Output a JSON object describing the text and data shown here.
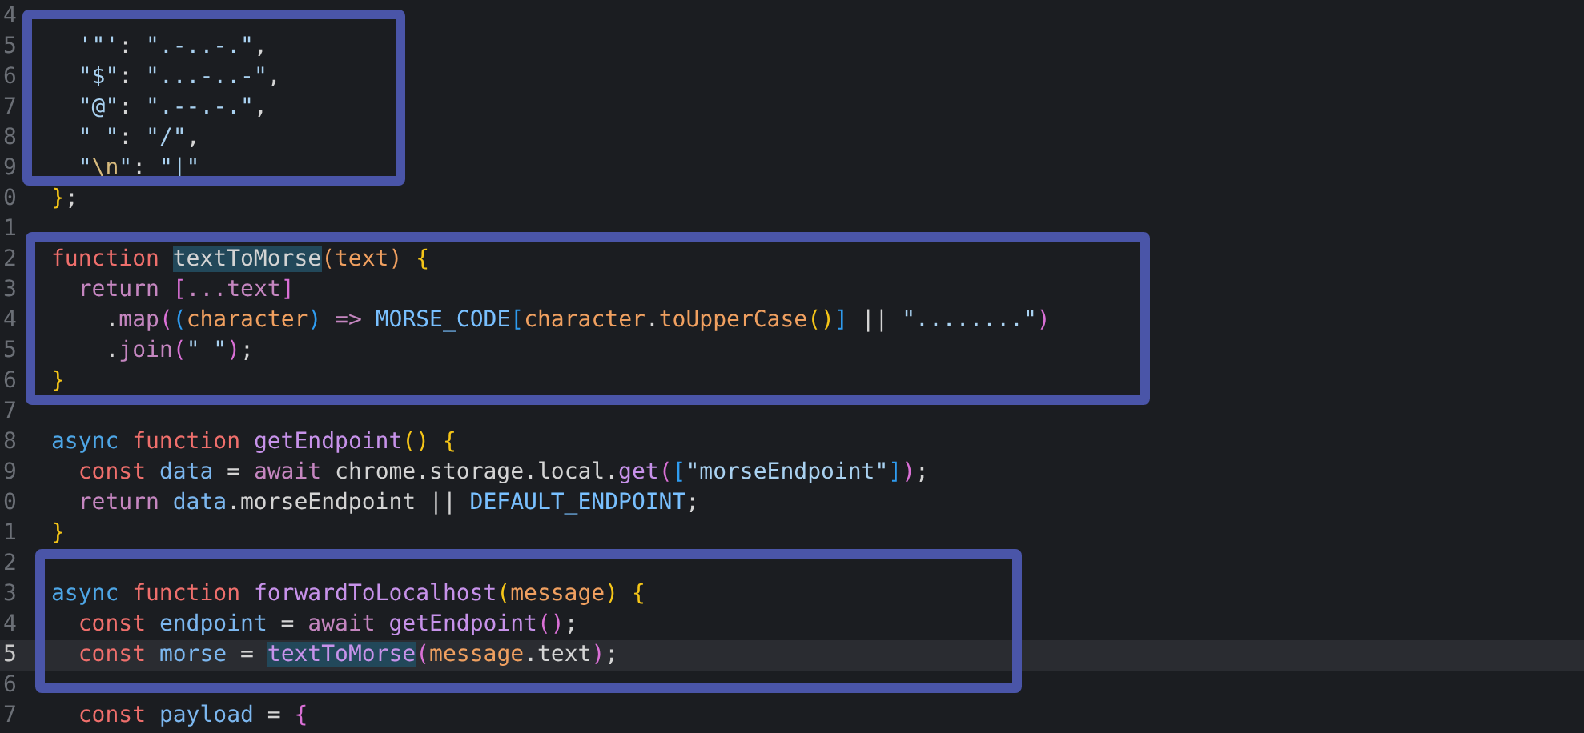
{
  "editor": {
    "lines": [
      {
        "num": "4",
        "active": false
      },
      {
        "num": "5",
        "active": false,
        "tokens": [
          {
            "t": "  '\"'",
            "kind": "str"
          },
          {
            "t": ": ",
            "kind": "plain"
          },
          {
            "t": "\".-..-.\"",
            "kind": "str"
          },
          {
            "t": ",",
            "kind": "plain"
          }
        ]
      },
      {
        "num": "6",
        "active": false,
        "tokens": [
          {
            "t": "  \"$\"",
            "kind": "str"
          },
          {
            "t": ": ",
            "kind": "plain"
          },
          {
            "t": "\"...-..-\"",
            "kind": "str"
          },
          {
            "t": ",",
            "kind": "plain"
          }
        ]
      },
      {
        "num": "7",
        "active": false,
        "tokens": [
          {
            "t": "  \"@\"",
            "kind": "str"
          },
          {
            "t": ": ",
            "kind": "plain"
          },
          {
            "t": "\".--.-.\"",
            "kind": "str"
          },
          {
            "t": ",",
            "kind": "plain"
          }
        ]
      },
      {
        "num": "8",
        "active": false,
        "tokens": [
          {
            "t": "  \" \"",
            "kind": "str"
          },
          {
            "t": ": ",
            "kind": "plain"
          },
          {
            "t": "\"/\"",
            "kind": "str"
          },
          {
            "t": ",",
            "kind": "plain"
          }
        ]
      },
      {
        "num": "9",
        "active": false,
        "tokens": [
          {
            "t": "  \"",
            "kind": "str"
          },
          {
            "t": "\\n",
            "kind": "esc"
          },
          {
            "t": "\"",
            "kind": "str"
          },
          {
            "t": ": ",
            "kind": "plain"
          },
          {
            "t": "\"|\"",
            "kind": "str"
          }
        ]
      },
      {
        "num": "0",
        "active": false,
        "tokens": [
          {
            "t": "}",
            "kind": "brace"
          },
          {
            "t": ";",
            "kind": "plain"
          }
        ]
      },
      {
        "num": "1",
        "active": false
      },
      {
        "num": "2",
        "active": false,
        "tokens": [
          {
            "t": "function ",
            "kind": "kw"
          },
          {
            "t": "textToMorse",
            "kind": "plain",
            "hl": true
          },
          {
            "t": "(text) ",
            "kind": "param"
          },
          {
            "t": "{",
            "kind": "brace"
          }
        ]
      },
      {
        "num": "3",
        "active": false,
        "tokens": [
          {
            "t": "  return ",
            "kind": "ctl"
          },
          {
            "t": "[",
            "kind": "paren"
          },
          {
            "t": "...text",
            "kind": "ctl"
          },
          {
            "t": "]",
            "kind": "paren"
          }
        ]
      },
      {
        "num": "4",
        "active": false,
        "tokens": [
          {
            "t": "    .",
            "kind": "plain"
          },
          {
            "t": "map",
            "kind": "ctl"
          },
          {
            "t": "(",
            "kind": "paren"
          },
          {
            "t": "(",
            "kind": "bracket"
          },
          {
            "t": "character",
            "kind": "param"
          },
          {
            "t": ")",
            "kind": "bracket"
          },
          {
            "t": " => ",
            "kind": "ctl"
          },
          {
            "t": "MORSE_CODE",
            "kind": "const"
          },
          {
            "t": "[",
            "kind": "bracket"
          },
          {
            "t": "character",
            "kind": "param"
          },
          {
            "t": ".",
            "kind": "plain"
          },
          {
            "t": "toUpperCase",
            "kind": "param"
          },
          {
            "t": "()",
            "kind": "brace"
          },
          {
            "t": "]",
            "kind": "bracket"
          },
          {
            "t": " || ",
            "kind": "plain"
          },
          {
            "t": "\"........\"",
            "kind": "str"
          },
          {
            "t": ")",
            "kind": "paren"
          }
        ]
      },
      {
        "num": "5",
        "active": false,
        "tokens": [
          {
            "t": "    .",
            "kind": "plain"
          },
          {
            "t": "join",
            "kind": "ctl"
          },
          {
            "t": "(",
            "kind": "paren"
          },
          {
            "t": "\" \"",
            "kind": "str"
          },
          {
            "t": ")",
            "kind": "paren"
          },
          {
            "t": ";",
            "kind": "plain"
          }
        ]
      },
      {
        "num": "6",
        "active": false,
        "tokens": [
          {
            "t": "}",
            "kind": "brace"
          }
        ]
      },
      {
        "num": "7",
        "active": false
      },
      {
        "num": "8",
        "active": false,
        "tokens": [
          {
            "t": "async ",
            "kind": "async"
          },
          {
            "t": "function ",
            "kind": "kw"
          },
          {
            "t": "getEndpoint",
            "kind": "fn"
          },
          {
            "t": "() {",
            "kind": "brace"
          }
        ]
      },
      {
        "num": "9",
        "active": false,
        "tokens": [
          {
            "t": "  const ",
            "kind": "kw"
          },
          {
            "t": "data",
            "kind": "var"
          },
          {
            "t": " = ",
            "kind": "plain"
          },
          {
            "t": "await",
            "kind": "ctl"
          },
          {
            "t": " chrome.storage.local.",
            "kind": "plain"
          },
          {
            "t": "get",
            "kind": "fn"
          },
          {
            "t": "(",
            "kind": "paren"
          },
          {
            "t": "[",
            "kind": "bracket"
          },
          {
            "t": "\"morseEndpoint\"",
            "kind": "str"
          },
          {
            "t": "]",
            "kind": "bracket"
          },
          {
            "t": ")",
            "kind": "paren"
          },
          {
            "t": ";",
            "kind": "plain"
          }
        ]
      },
      {
        "num": "0",
        "active": false,
        "tokens": [
          {
            "t": "  return ",
            "kind": "ctl"
          },
          {
            "t": "data",
            "kind": "var"
          },
          {
            "t": ".morseEndpoint || ",
            "kind": "plain"
          },
          {
            "t": "DEFAULT_ENDPOINT",
            "kind": "const"
          },
          {
            "t": ";",
            "kind": "plain"
          }
        ]
      },
      {
        "num": "1",
        "active": false,
        "tokens": [
          {
            "t": "}",
            "kind": "brace"
          }
        ]
      },
      {
        "num": "2",
        "active": false
      },
      {
        "num": "3",
        "active": false,
        "tokens": [
          {
            "t": "async ",
            "kind": "async"
          },
          {
            "t": "function ",
            "kind": "kw"
          },
          {
            "t": "forwardToLocalhost",
            "kind": "fn"
          },
          {
            "t": "(",
            "kind": "brace"
          },
          {
            "t": "message",
            "kind": "param"
          },
          {
            "t": ") {",
            "kind": "brace"
          }
        ]
      },
      {
        "num": "4",
        "active": false,
        "tokens": [
          {
            "t": "  const ",
            "kind": "kw"
          },
          {
            "t": "endpoint",
            "kind": "var"
          },
          {
            "t": " = ",
            "kind": "plain"
          },
          {
            "t": "await ",
            "kind": "ctl"
          },
          {
            "t": "getEndpoint",
            "kind": "fn"
          },
          {
            "t": "()",
            "kind": "paren"
          },
          {
            "t": ";",
            "kind": "plain"
          }
        ]
      },
      {
        "num": "5",
        "active": true,
        "tokens": [
          {
            "t": "  const ",
            "kind": "kw"
          },
          {
            "t": "morse",
            "kind": "var"
          },
          {
            "t": " = ",
            "kind": "plain"
          },
          {
            "t": "textToMorse",
            "kind": "fn",
            "hl": true
          },
          {
            "t": "(",
            "kind": "paren"
          },
          {
            "t": "message",
            "kind": "param"
          },
          {
            "t": ".text",
            "kind": "plain"
          },
          {
            "t": ")",
            "kind": "paren"
          },
          {
            "t": ";",
            "kind": "plain"
          }
        ]
      },
      {
        "num": "6",
        "active": false
      },
      {
        "num": "7",
        "active": false,
        "tokens": [
          {
            "t": "  const ",
            "kind": "kw"
          },
          {
            "t": "payload",
            "kind": "var"
          },
          {
            "t": " = ",
            "kind": "plain"
          },
          {
            "t": "{",
            "kind": "paren"
          }
        ]
      }
    ]
  }
}
